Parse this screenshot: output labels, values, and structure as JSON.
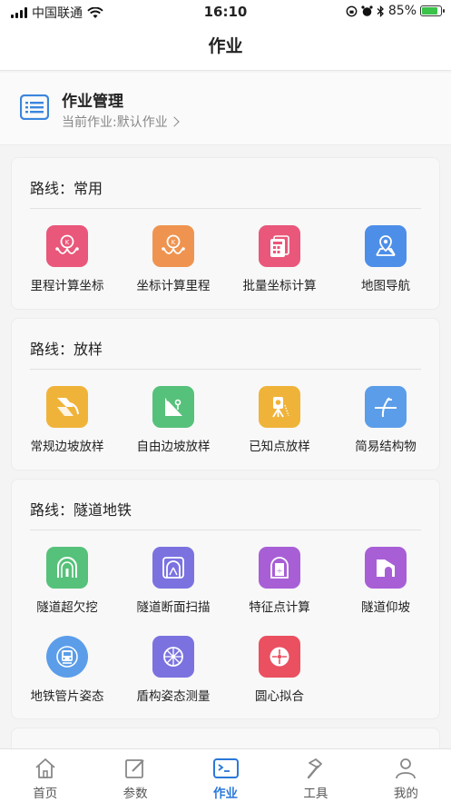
{
  "status_bar": {
    "carrier": "中国联通",
    "time": "16:10",
    "battery": "85%",
    "battery_level": 0.85
  },
  "nav": {
    "title": "作业"
  },
  "manage": {
    "title": "作业管理",
    "subtitle": "当前作业:默认作业"
  },
  "sections": [
    {
      "title": "路线：常用",
      "items": [
        {
          "label": "里程计算坐标",
          "color": "#e9577a",
          "icon": "mileage-to-coordinate-icon"
        },
        {
          "label": "坐标计算里程",
          "color": "#ef9450",
          "icon": "coordinate-to-mileage-icon"
        },
        {
          "label": "批量坐标计算",
          "color": "#e9577a",
          "icon": "batch-calculation-icon"
        },
        {
          "label": "地图导航",
          "color": "#4d8ee8",
          "icon": "map-navigation-icon"
        }
      ]
    },
    {
      "title": "路线：放样",
      "items": [
        {
          "label": "常规边坡放样",
          "color": "#f0b33a",
          "icon": "slope-stakeout-icon"
        },
        {
          "label": "自由边坡放样",
          "color": "#56c17a",
          "icon": "free-slope-icon"
        },
        {
          "label": "已知点放样",
          "color": "#f0b33a",
          "icon": "known-point-stakeout-icon"
        },
        {
          "label": "简易结构物",
          "color": "#5b9de9",
          "icon": "structure-icon"
        }
      ]
    },
    {
      "title": "路线：隧道地铁",
      "items": [
        {
          "label": "隧道超欠挖",
          "color": "#56c17a",
          "icon": "tunnel-overbreak-icon"
        },
        {
          "label": "隧道断面扫描",
          "color": "#7b72e0",
          "icon": "tunnel-section-scan-icon"
        },
        {
          "label": "特征点计算",
          "color": "#a85fd6",
          "icon": "feature-point-icon"
        },
        {
          "label": "隧道仰坡",
          "color": "#a85fd6",
          "icon": "tunnel-slope-icon"
        },
        {
          "label": "地铁管片姿态",
          "color": "#5b9de9",
          "icon": "subway-segment-icon"
        },
        {
          "label": "盾构姿态测量",
          "color": "#7b72e0",
          "icon": "shield-attitude-icon"
        },
        {
          "label": "圆心拟合",
          "color": "#ea5060",
          "icon": "circle-fit-icon"
        }
      ]
    }
  ],
  "tabbar": [
    {
      "label": "首页",
      "icon": "home-icon",
      "active": false
    },
    {
      "label": "参数",
      "icon": "edit-icon",
      "active": false
    },
    {
      "label": "作业",
      "icon": "terminal-icon",
      "active": true
    },
    {
      "label": "工具",
      "icon": "hammer-icon",
      "active": false
    },
    {
      "label": "我的",
      "icon": "user-icon",
      "active": false
    }
  ]
}
